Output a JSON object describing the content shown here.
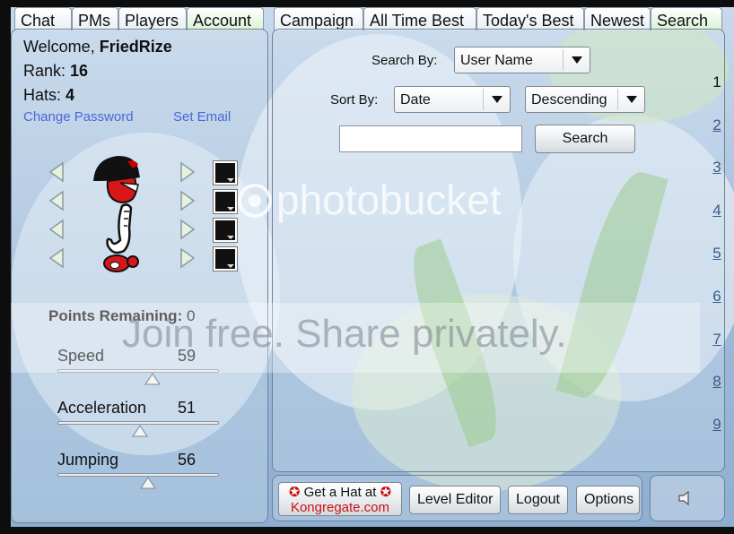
{
  "tabs_left": [
    "Chat",
    "PMs",
    "Players",
    "Account"
  ],
  "tabs_right": [
    "Campaign",
    "All Time Best",
    "Today's Best",
    "Newest",
    "Search"
  ],
  "account": {
    "welcome_prefix": "Welcome,",
    "username": "FriedRize",
    "rank_label": "Rank:",
    "rank_value": "16",
    "hats_label": "Hats:",
    "hats_value": "4",
    "change_password": "Change Password",
    "set_email": "Set Email"
  },
  "stats": {
    "points_label": "Points Remaining:",
    "points_value": "0",
    "speed_label": "Speed",
    "speed_value": 59,
    "accel_label": "Acceleration",
    "accel_value": 51,
    "jump_label": "Jumping",
    "jump_value": 56
  },
  "search": {
    "search_by_label": "Search By:",
    "search_by_value": "User Name",
    "sort_by_label": "Sort By:",
    "sort_field": "Date",
    "sort_order": "Descending",
    "query": "",
    "button": "Search"
  },
  "pages": [
    "1",
    "2",
    "3",
    "4",
    "5",
    "6",
    "7",
    "8",
    "9"
  ],
  "bottom": {
    "hat_line1": "Get a Hat at",
    "hat_line2": "Kongregate.com",
    "level_editor": "Level Editor",
    "logout": "Logout",
    "options": "Options"
  },
  "watermark": {
    "logo": "photobucket",
    "slogan": "Join free. Share privately."
  },
  "colors": {
    "link": "#4a68d8",
    "active_tab": "#d8f2d2",
    "kongregate_red": "#cc1111"
  }
}
